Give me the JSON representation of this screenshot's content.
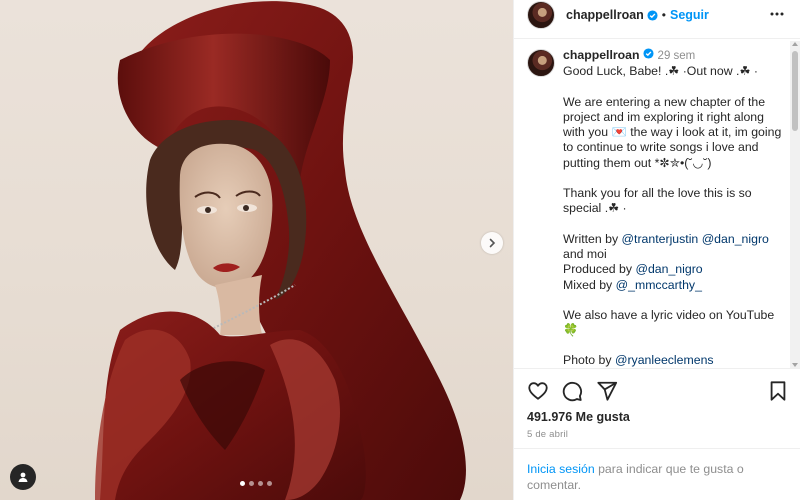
{
  "post": {
    "username": "chappellroan",
    "follow_label": "Seguir",
    "separator": "•",
    "time": "29 sem",
    "caption": [
      "Good Luck, Babe! .☘︎ ·Out now .☘︎ ·",
      "We are entering a new chapter of the project and im exploring it right along with you 💌 the way i look at it, im going to continue to write songs i love and putting them out *✼✮•(˘◡˘)",
      "Thank you for all the love this is so special .☘︎ ·",
      "",
      "We also have a lyric video on YouTube 🍀",
      ""
    ],
    "credits": {
      "written_prefix": "Written by ",
      "written_mention1": "@tranterjustin",
      "written_mention2": "@dan_nigro",
      "written_suffix": "and moi",
      "produced_prefix": "Produced by ",
      "produced_mention": "@dan_nigro",
      "mixed_prefix": "Mixed by ",
      "mixed_mention": "@_mmccarthy_",
      "photo_prefix": "Photo by ",
      "photo_mention": "@ryanleeclemens"
    },
    "likes": "491.976 Me gusta",
    "date": "5 de abril",
    "login_link": "Inicia sesión",
    "login_text": " para indicar que te gusta o comentar."
  },
  "carousel": {
    "total": 4,
    "active": 0
  },
  "icons": {
    "verified": "verified-badge-icon",
    "more": "more-options-icon",
    "like": "heart-icon",
    "comment": "comment-icon",
    "share": "share-icon",
    "save": "bookmark-icon",
    "next": "chevron-right-icon",
    "tag": "user-tag-icon"
  },
  "colors": {
    "accent": "#0095f6",
    "verified": "#0095f6",
    "mention": "#00376b",
    "secondary_text": "#8e8e8e"
  }
}
